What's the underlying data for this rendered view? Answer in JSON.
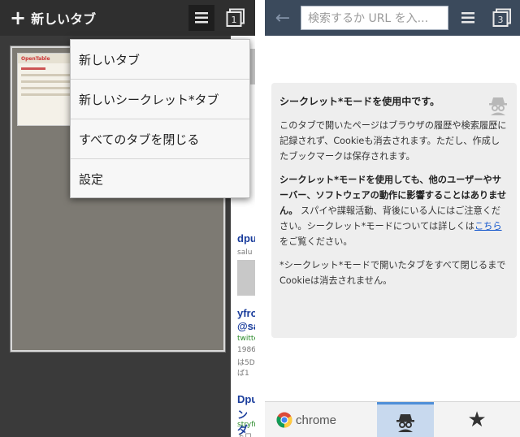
{
  "left": {
    "new_tab_label": "新しいタブ",
    "menu": [
      "新しいタブ",
      "新しいシークレット*タブ",
      "すべてのタブを閉じる",
      "設定"
    ],
    "tab_count": "1",
    "thumb_logo": "OpenTable",
    "background_page": {
      "link1": "dpu",
      "gray1": "salu",
      "link2a": "yfro",
      "link2b": "@sa",
      "green1": "twitte",
      "gray2a": "1986",
      "gray2b": "は5D",
      "gray2c": "ば1",
      "link3a": "Dpu",
      "link3b": "ンダ",
      "green2": "stryfr",
      "gray3": "トロ"
    }
  },
  "right": {
    "omnibox_placeholder": "検索するか URL を入...",
    "tab_count": "3",
    "incognito": {
      "title": "シークレット*モードを使用中です。",
      "p1": "このタブで開いたページはブラウザの履歴や検索履歴に記録されず、Cookieも消去されます。ただし、作成したブックマークは保存されます。",
      "p2_bold": "シークレット*モードを使用しても、他のユーザーやサーバー、ソフトウェアの動作に影響することはありません。",
      "p2_rest_a": "スパイや諜報活動、背後にいる人にはご注意ください。シークレット*モードについては詳しくは",
      "p2_link": "こちら",
      "p2_rest_b": "をご覧ください。",
      "p3": "*シークレット*モードで開いたタブをすべて閉じるまでCookieは消去されません。"
    },
    "bottom": {
      "chrome_label": "chrome"
    }
  }
}
